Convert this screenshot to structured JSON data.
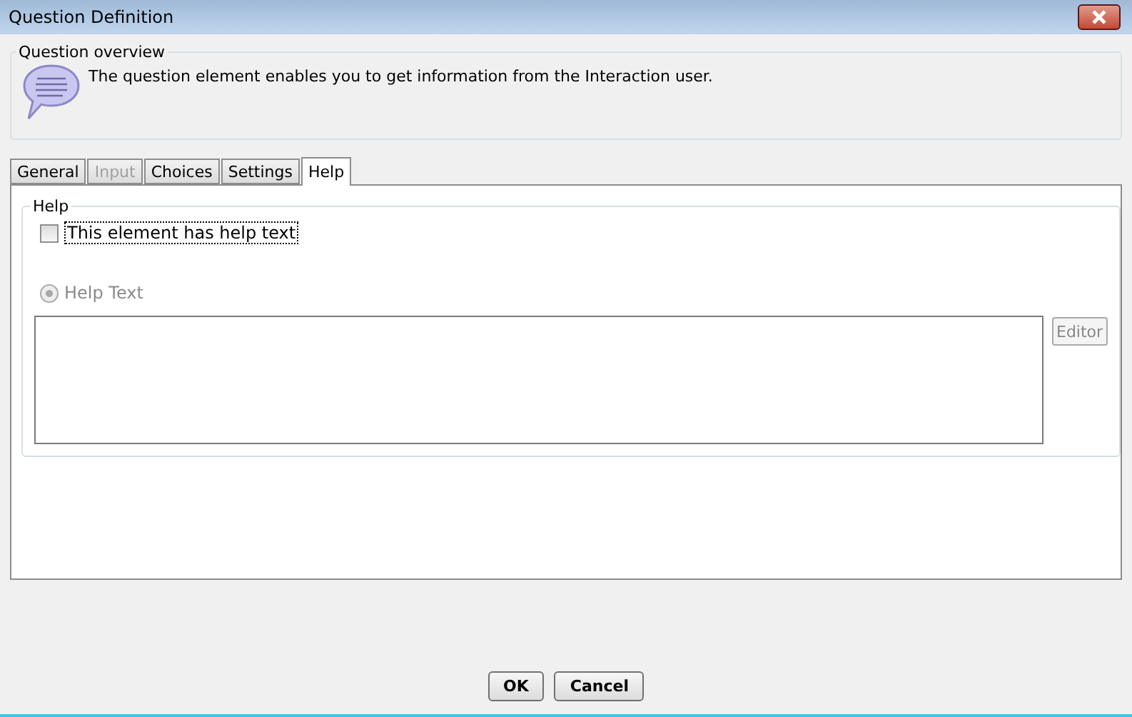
{
  "window": {
    "title": "Question Definition"
  },
  "overview": {
    "title": "Question overview",
    "text": "The question element enables you to get information from the Interaction user."
  },
  "tabs": [
    {
      "label": "General",
      "selected": false,
      "disabled": false
    },
    {
      "label": "Input",
      "selected": false,
      "disabled": true
    },
    {
      "label": "Choices",
      "selected": false,
      "disabled": false
    },
    {
      "label": "Settings",
      "selected": false,
      "disabled": false
    },
    {
      "label": "Help",
      "selected": true,
      "disabled": false
    }
  ],
  "help": {
    "title": "Help",
    "checkbox": {
      "label": "This element has help text",
      "checked": false
    },
    "radio": {
      "label": "Help Text",
      "selected": true,
      "disabled": true
    },
    "editor_button": {
      "label": "Editor",
      "disabled": true
    }
  },
  "buttons": [
    "OK",
    "Cancel"
  ]
}
